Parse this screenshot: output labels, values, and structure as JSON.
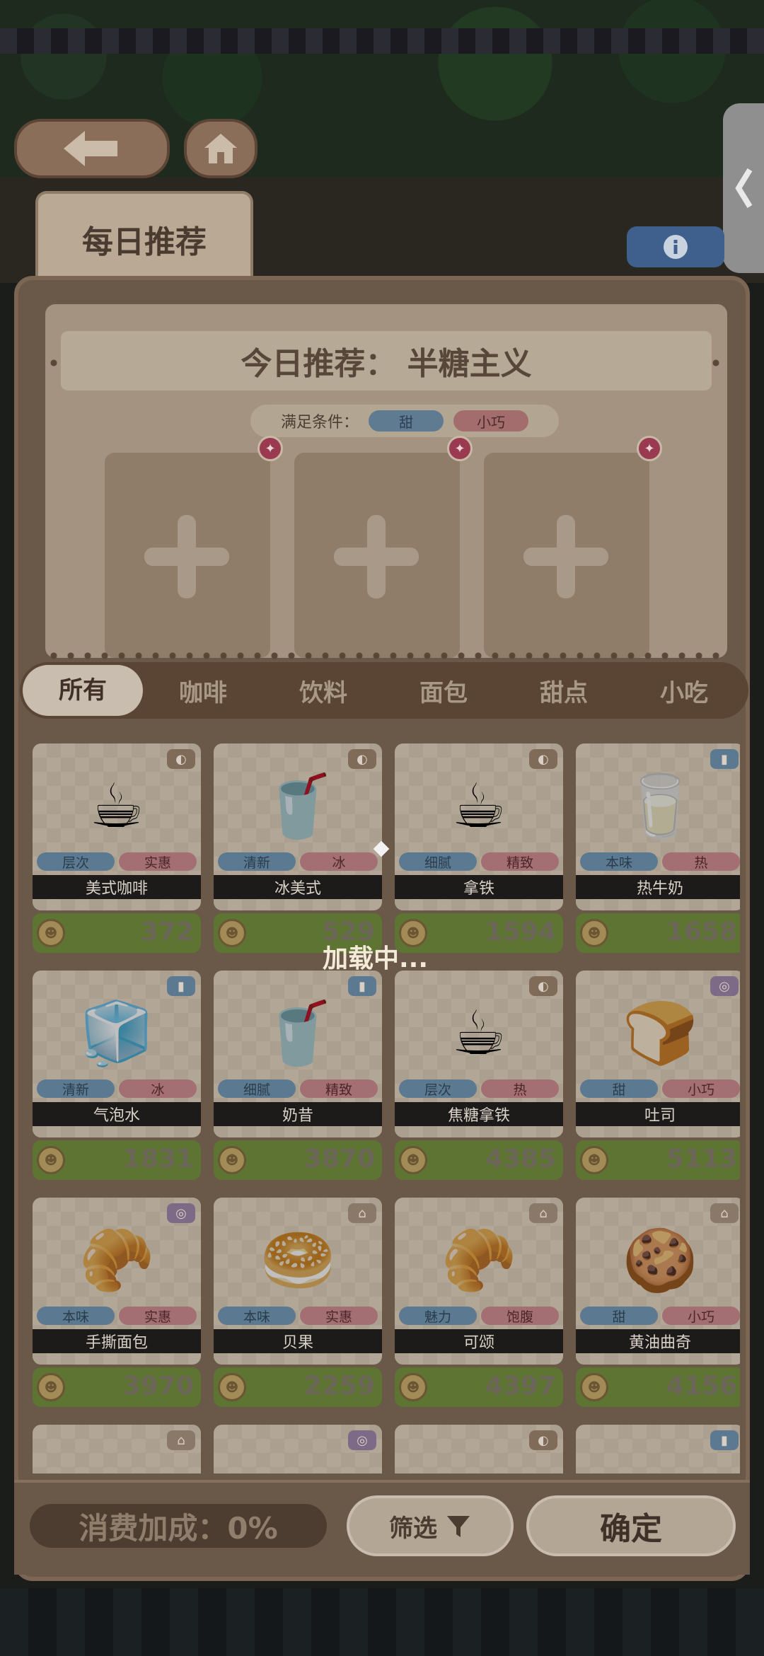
{
  "header": {
    "daily_tab_label": "每日推荐",
    "recommend_title": "今日推荐：  半糖主义",
    "condition_label": "满足条件：",
    "conditions": [
      "甜",
      "小巧"
    ]
  },
  "slots": [
    {
      "badge": "✦"
    },
    {
      "badge": "✦"
    },
    {
      "badge": "✦"
    }
  ],
  "tabs": [
    "所有",
    "咖啡",
    "饮料",
    "面包",
    "甜点",
    "小吃"
  ],
  "items": [
    {
      "name": "美式咖啡",
      "tags": [
        "层次",
        "实惠"
      ],
      "price": "372",
      "category_icon": "coffee-bean-icon",
      "icon": "☕"
    },
    {
      "name": "冰美式",
      "tags": [
        "清新",
        "冰"
      ],
      "price": "529",
      "category_icon": "coffee-bean-icon",
      "icon": "🥤"
    },
    {
      "name": "拿铁",
      "tags": [
        "细腻",
        "精致"
      ],
      "price": "1594",
      "category_icon": "coffee-bean-icon",
      "icon": "☕"
    },
    {
      "name": "热牛奶",
      "tags": [
        "本味",
        "热"
      ],
      "price": "1658",
      "category_icon": "cup-icon",
      "icon": "🥛"
    },
    {
      "name": "气泡水",
      "tags": [
        "清新",
        "冰"
      ],
      "price": "1831",
      "category_icon": "cup-icon",
      "icon": "🧊"
    },
    {
      "name": "奶昔",
      "tags": [
        "细腻",
        "精致"
      ],
      "price": "3870",
      "category_icon": "cup-icon",
      "icon": "🥤"
    },
    {
      "name": "焦糖拿铁",
      "tags": [
        "层次",
        "热"
      ],
      "price": "4385",
      "category_icon": "coffee-bean-icon",
      "icon": "☕"
    },
    {
      "name": "吐司",
      "tags": [
        "甜",
        "小巧"
      ],
      "price": "5113",
      "category_icon": "candy-icon",
      "icon": "🍞"
    },
    {
      "name": "手撕面包",
      "tags": [
        "本味",
        "实惠"
      ],
      "price": "3970",
      "category_icon": "candy-icon",
      "icon": "🥐"
    },
    {
      "name": "贝果",
      "tags": [
        "本味",
        "实惠"
      ],
      "price": "2259",
      "category_icon": "bread-icon",
      "icon": "🥯"
    },
    {
      "name": "可颂",
      "tags": [
        "魅力",
        "饱腹"
      ],
      "price": "4397",
      "category_icon": "bread-icon",
      "icon": "🥐"
    },
    {
      "name": "黄油曲奇",
      "tags": [
        "甜",
        "小巧"
      ],
      "price": "4156",
      "category_icon": "bread-icon",
      "icon": "🍪"
    },
    {
      "name": "",
      "tags": [],
      "price": "",
      "category_icon": "bread-icon",
      "icon": ""
    },
    {
      "name": "",
      "tags": [],
      "price": "",
      "category_icon": "candy-icon",
      "icon": ""
    },
    {
      "name": "",
      "tags": [],
      "price": "",
      "category_icon": "coffee-bean-icon",
      "icon": ""
    },
    {
      "name": "",
      "tags": [],
      "price": "",
      "category_icon": "cup-icon",
      "icon": ""
    }
  ],
  "loading_text": "加载中...",
  "bottom": {
    "bonus_label": "消费加成：0%",
    "filter_label": "筛选",
    "confirm_label": "确定"
  },
  "colors": {
    "accent_blue": "#5b7990",
    "accent_pink": "#a46f72",
    "price_green": "#5d7433",
    "panel_brown": "#6a5848"
  }
}
